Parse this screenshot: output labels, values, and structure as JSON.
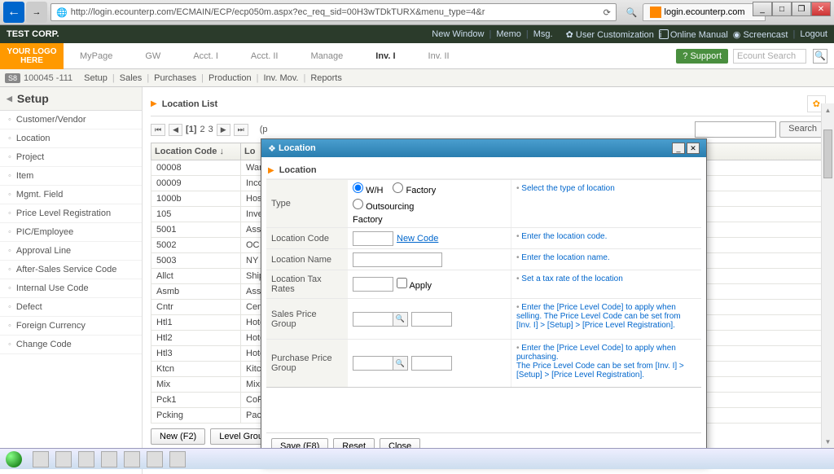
{
  "browser": {
    "url": "http://login.ecounterp.com/ECMAIN/ECP/ecp050m.aspx?ec_req_sid=00H3wTDkTURX&menu_type=4&r",
    "tab_title": "login.ecounterp.com"
  },
  "corp": {
    "name": "TEST CORP.",
    "links": [
      "New Window",
      "Memo",
      "Msg."
    ],
    "user_custom": "User Customization",
    "online_manual": "Online Manual",
    "screencast": "Screencast",
    "logout": "Logout"
  },
  "logo": "YOUR LOGO HERE",
  "mainnav": [
    "MyPage",
    "GW",
    "Acct. I",
    "Acct. II",
    "Manage",
    "Inv. I",
    "Inv. II"
  ],
  "mainnav_active": 5,
  "support": "Support",
  "search_placeholder": "Ecount Search",
  "subnav": {
    "badge": "S8",
    "code": "100045 -111",
    "items": [
      "Setup",
      "Sales",
      "Purchases",
      "Production",
      "Inv. Mov.",
      "Reports"
    ]
  },
  "sidebar": {
    "title": "Setup",
    "items": [
      "Customer/Vendor",
      "Location",
      "Project",
      "Item",
      "Mgmt. Field",
      "Price Level Registration",
      "PIC/Employee",
      "Approval Line",
      "After-Sales Service Code",
      "Internal Use Code",
      "Defect",
      "Foreign Currency",
      "Change Code"
    ]
  },
  "loclist": {
    "title": "Location List",
    "pages": [
      "[1]",
      "2",
      "3"
    ],
    "search": "Search",
    "headers": [
      "Location Code ↓",
      "Lo"
    ],
    "rows": [
      [
        "00008",
        "Ware"
      ],
      [
        "00009",
        "Inco"
      ],
      [
        "1000b",
        "Hosp"
      ],
      [
        "105",
        "Inve"
      ],
      [
        "5001",
        "Asse"
      ],
      [
        "5002",
        "OC E"
      ],
      [
        "5003",
        "NY E"
      ],
      [
        "Allct",
        "Ship"
      ],
      [
        "Asmb",
        "Asse"
      ],
      [
        "Cntr",
        "Cent"
      ],
      [
        "Htl1",
        "Hote"
      ],
      [
        "Htl2",
        "Hote"
      ],
      [
        "Htl3",
        "Hote"
      ],
      [
        "Ktcn",
        "Kitch"
      ],
      [
        "Mix",
        "Mixin"
      ],
      [
        "Pck1",
        "CoP"
      ],
      [
        "Pcking",
        "Packing"
      ]
    ],
    "buttons": [
      "New (F2)",
      "Level Group"
    ]
  },
  "modal": {
    "title": "Location",
    "section": "Location",
    "fields": {
      "type": {
        "label": "Type",
        "options": [
          "W/H",
          "Factory",
          "Outsourcing"
        ],
        "selected": 0,
        "extra": "Factory",
        "help": "Select the type of location"
      },
      "code": {
        "label": "Location Code",
        "link": "New Code",
        "help": "Enter the location code."
      },
      "name": {
        "label": "Location Name",
        "help": "Enter the location name."
      },
      "tax": {
        "label": "Location Tax Rates",
        "apply": "Apply",
        "help": "Set a tax rate of the location"
      },
      "sales": {
        "label": "Sales Price Group",
        "help": "Enter the [Price Level Code] to apply when selling. The Price Level Code can be set from [Inv. I] > [Setup] > [Price Level Registration]."
      },
      "purchase": {
        "label": "Purchase Price Group",
        "help": "Enter the [Price Level Code] to apply when purchasing.\nThe Price Level Code can be set from [Inv. I] > [Setup] > [Price Level Registration]."
      }
    },
    "buttons": [
      "Save (F8)",
      "Reset",
      "Close"
    ]
  }
}
